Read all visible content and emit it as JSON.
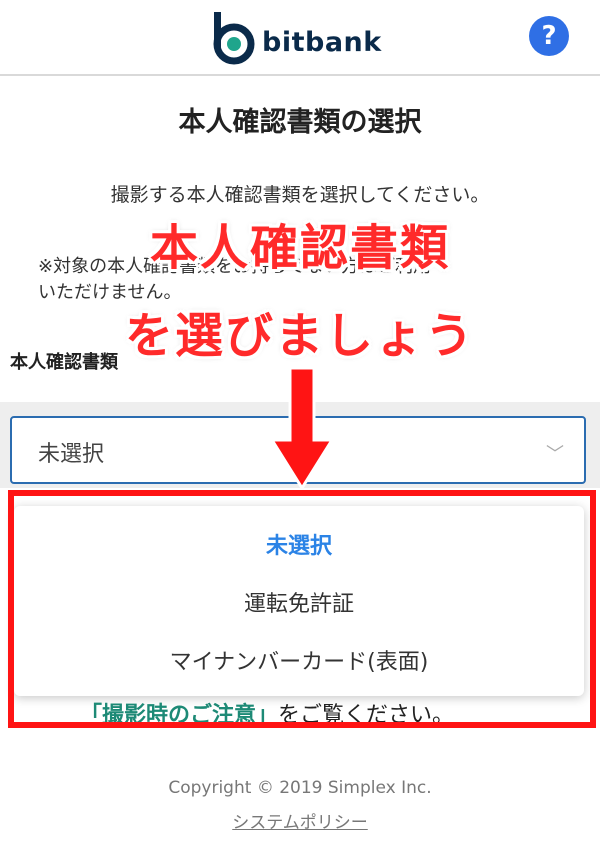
{
  "header": {
    "logo_text": "bitbank",
    "help_label": "?",
    "logo_icon": "bitbank-logo-icon",
    "help_icon": "question-icon",
    "brand_color": "#0a2a4a",
    "help_color": "#2f6fe5"
  },
  "main": {
    "title": "本人確認書類の選択",
    "instruction": "撮影する本人確認書類を選択してください。",
    "note_line1": "※対象の本人確認書類をお持ちでない方はご利用",
    "note_line2": "いただけません。",
    "field_label": "本人確認書類",
    "select": {
      "value": "未選択",
      "caret": "﹀",
      "options": [
        "未選択",
        "運転免許証",
        "マイナンバーカード(表面)"
      ],
      "selected_index": 0
    },
    "caution_link": "「撮影時のご注意」",
    "caution_rest": "をご覧ください。"
  },
  "annotation": {
    "line1": "本人確認書類",
    "line2": "を選びましょう",
    "color": "#ff1414",
    "arrow_icon": "down-arrow-icon"
  },
  "footer": {
    "copyright": "Copyright © 2019 Simplex Inc.",
    "policy_link": "システムポリシー"
  }
}
